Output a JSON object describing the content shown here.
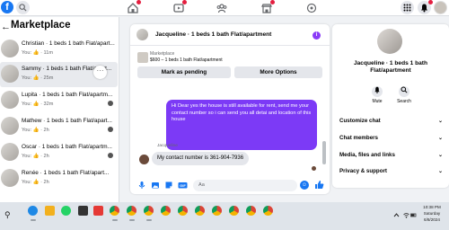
{
  "topbar": {
    "logo_letter": "f",
    "nav_icons": [
      "home-icon",
      "video-icon",
      "groups-icon",
      "marketplace-icon",
      "gaming-icon"
    ],
    "right_icons": [
      "menu-grid-icon",
      "messenger-icon",
      "notifications-icon"
    ]
  },
  "sidebar": {
    "back_glyph": "←",
    "title": "Marketplace",
    "conversations": [
      {
        "name": "Christian · 1 beds 1 bath Flat/apart...",
        "you": "You:",
        "time": "· 11m"
      },
      {
        "name": "Sammy · 1 beds 1 bath Flat/apart...",
        "you": "You:",
        "time": "· 25m",
        "selected": true
      },
      {
        "name": "Lupita · 1 beds 1 bath Flat/apartm...",
        "you": "You:",
        "time": "· 32m"
      },
      {
        "name": "Mathew · 1 beds 1 bath Flat/apart...",
        "you": "You:",
        "time": "· 2h"
      },
      {
        "name": "Oscar · 1 beds 1 bath Flat/apartm...",
        "you": "You:",
        "time": "· 2h"
      },
      {
        "name": "Renée · 1 beds 1 bath Flat/apart...",
        "you": "You:",
        "time": "· 2h"
      }
    ],
    "more_glyph": "···"
  },
  "chat": {
    "title": "Jacqueline · 1 beds 1 bath Flat/apartment",
    "info_glyph": "i",
    "marketplace_label": "Marketplace",
    "listing": "$600 – 1 beds 1 bath Flat/apartment",
    "mark_pending": "Mark as pending",
    "more_options": "More Options",
    "outgoing_message": "Hi Dear yes the house is still available for rent, send me your contact number so i can send you all detai and location of this house",
    "incoming_sender": "Jacqueline",
    "incoming_message": "My contact number is 361-904-7936",
    "composer_placeholder": "Aa",
    "emoji_glyph": "☺"
  },
  "info_panel": {
    "name_line1": "Jacqueline · 1 beds 1 bath",
    "name_line2": "Flat/apartment",
    "mute_label": "Mute",
    "search_label": "Search",
    "sections": [
      "Customize chat",
      "Chat members",
      "Media, files and links",
      "Privacy & support"
    ],
    "chevron": "⌄"
  },
  "taskbar": {
    "search_glyph": "⚲",
    "time": "10:38 PM",
    "day": "Saturday",
    "date": "6/8/2024"
  },
  "colors": {
    "brand": "#1877f2",
    "message_bubble": "#7c3af6",
    "background": "#f0f2f5"
  }
}
